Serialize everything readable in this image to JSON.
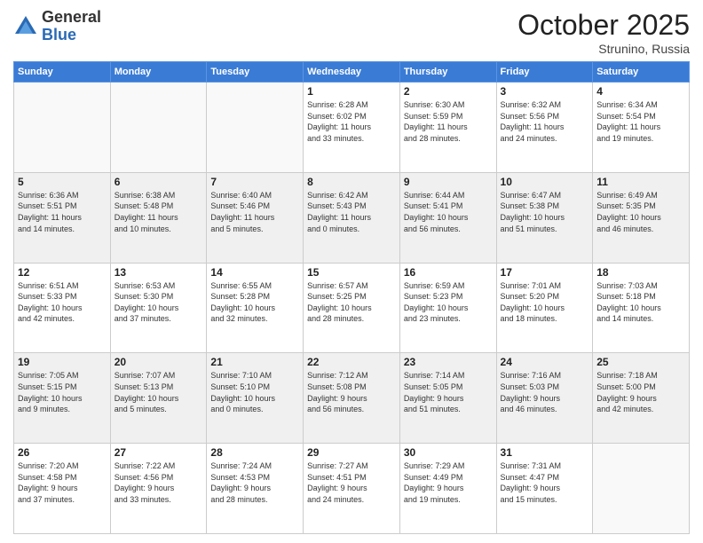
{
  "header": {
    "logo_general": "General",
    "logo_blue": "Blue",
    "month": "October 2025",
    "location": "Strunino, Russia"
  },
  "days_of_week": [
    "Sunday",
    "Monday",
    "Tuesday",
    "Wednesday",
    "Thursday",
    "Friday",
    "Saturday"
  ],
  "weeks": [
    [
      {
        "day": "",
        "info": ""
      },
      {
        "day": "",
        "info": ""
      },
      {
        "day": "",
        "info": ""
      },
      {
        "day": "1",
        "info": "Sunrise: 6:28 AM\nSunset: 6:02 PM\nDaylight: 11 hours\nand 33 minutes."
      },
      {
        "day": "2",
        "info": "Sunrise: 6:30 AM\nSunset: 5:59 PM\nDaylight: 11 hours\nand 28 minutes."
      },
      {
        "day": "3",
        "info": "Sunrise: 6:32 AM\nSunset: 5:56 PM\nDaylight: 11 hours\nand 24 minutes."
      },
      {
        "day": "4",
        "info": "Sunrise: 6:34 AM\nSunset: 5:54 PM\nDaylight: 11 hours\nand 19 minutes."
      }
    ],
    [
      {
        "day": "5",
        "info": "Sunrise: 6:36 AM\nSunset: 5:51 PM\nDaylight: 11 hours\nand 14 minutes."
      },
      {
        "day": "6",
        "info": "Sunrise: 6:38 AM\nSunset: 5:48 PM\nDaylight: 11 hours\nand 10 minutes."
      },
      {
        "day": "7",
        "info": "Sunrise: 6:40 AM\nSunset: 5:46 PM\nDaylight: 11 hours\nand 5 minutes."
      },
      {
        "day": "8",
        "info": "Sunrise: 6:42 AM\nSunset: 5:43 PM\nDaylight: 11 hours\nand 0 minutes."
      },
      {
        "day": "9",
        "info": "Sunrise: 6:44 AM\nSunset: 5:41 PM\nDaylight: 10 hours\nand 56 minutes."
      },
      {
        "day": "10",
        "info": "Sunrise: 6:47 AM\nSunset: 5:38 PM\nDaylight: 10 hours\nand 51 minutes."
      },
      {
        "day": "11",
        "info": "Sunrise: 6:49 AM\nSunset: 5:35 PM\nDaylight: 10 hours\nand 46 minutes."
      }
    ],
    [
      {
        "day": "12",
        "info": "Sunrise: 6:51 AM\nSunset: 5:33 PM\nDaylight: 10 hours\nand 42 minutes."
      },
      {
        "day": "13",
        "info": "Sunrise: 6:53 AM\nSunset: 5:30 PM\nDaylight: 10 hours\nand 37 minutes."
      },
      {
        "day": "14",
        "info": "Sunrise: 6:55 AM\nSunset: 5:28 PM\nDaylight: 10 hours\nand 32 minutes."
      },
      {
        "day": "15",
        "info": "Sunrise: 6:57 AM\nSunset: 5:25 PM\nDaylight: 10 hours\nand 28 minutes."
      },
      {
        "day": "16",
        "info": "Sunrise: 6:59 AM\nSunset: 5:23 PM\nDaylight: 10 hours\nand 23 minutes."
      },
      {
        "day": "17",
        "info": "Sunrise: 7:01 AM\nSunset: 5:20 PM\nDaylight: 10 hours\nand 18 minutes."
      },
      {
        "day": "18",
        "info": "Sunrise: 7:03 AM\nSunset: 5:18 PM\nDaylight: 10 hours\nand 14 minutes."
      }
    ],
    [
      {
        "day": "19",
        "info": "Sunrise: 7:05 AM\nSunset: 5:15 PM\nDaylight: 10 hours\nand 9 minutes."
      },
      {
        "day": "20",
        "info": "Sunrise: 7:07 AM\nSunset: 5:13 PM\nDaylight: 10 hours\nand 5 minutes."
      },
      {
        "day": "21",
        "info": "Sunrise: 7:10 AM\nSunset: 5:10 PM\nDaylight: 10 hours\nand 0 minutes."
      },
      {
        "day": "22",
        "info": "Sunrise: 7:12 AM\nSunset: 5:08 PM\nDaylight: 9 hours\nand 56 minutes."
      },
      {
        "day": "23",
        "info": "Sunrise: 7:14 AM\nSunset: 5:05 PM\nDaylight: 9 hours\nand 51 minutes."
      },
      {
        "day": "24",
        "info": "Sunrise: 7:16 AM\nSunset: 5:03 PM\nDaylight: 9 hours\nand 46 minutes."
      },
      {
        "day": "25",
        "info": "Sunrise: 7:18 AM\nSunset: 5:00 PM\nDaylight: 9 hours\nand 42 minutes."
      }
    ],
    [
      {
        "day": "26",
        "info": "Sunrise: 7:20 AM\nSunset: 4:58 PM\nDaylight: 9 hours\nand 37 minutes."
      },
      {
        "day": "27",
        "info": "Sunrise: 7:22 AM\nSunset: 4:56 PM\nDaylight: 9 hours\nand 33 minutes."
      },
      {
        "day": "28",
        "info": "Sunrise: 7:24 AM\nSunset: 4:53 PM\nDaylight: 9 hours\nand 28 minutes."
      },
      {
        "day": "29",
        "info": "Sunrise: 7:27 AM\nSunset: 4:51 PM\nDaylight: 9 hours\nand 24 minutes."
      },
      {
        "day": "30",
        "info": "Sunrise: 7:29 AM\nSunset: 4:49 PM\nDaylight: 9 hours\nand 19 minutes."
      },
      {
        "day": "31",
        "info": "Sunrise: 7:31 AM\nSunset: 4:47 PM\nDaylight: 9 hours\nand 15 minutes."
      },
      {
        "day": "",
        "info": ""
      }
    ]
  ]
}
